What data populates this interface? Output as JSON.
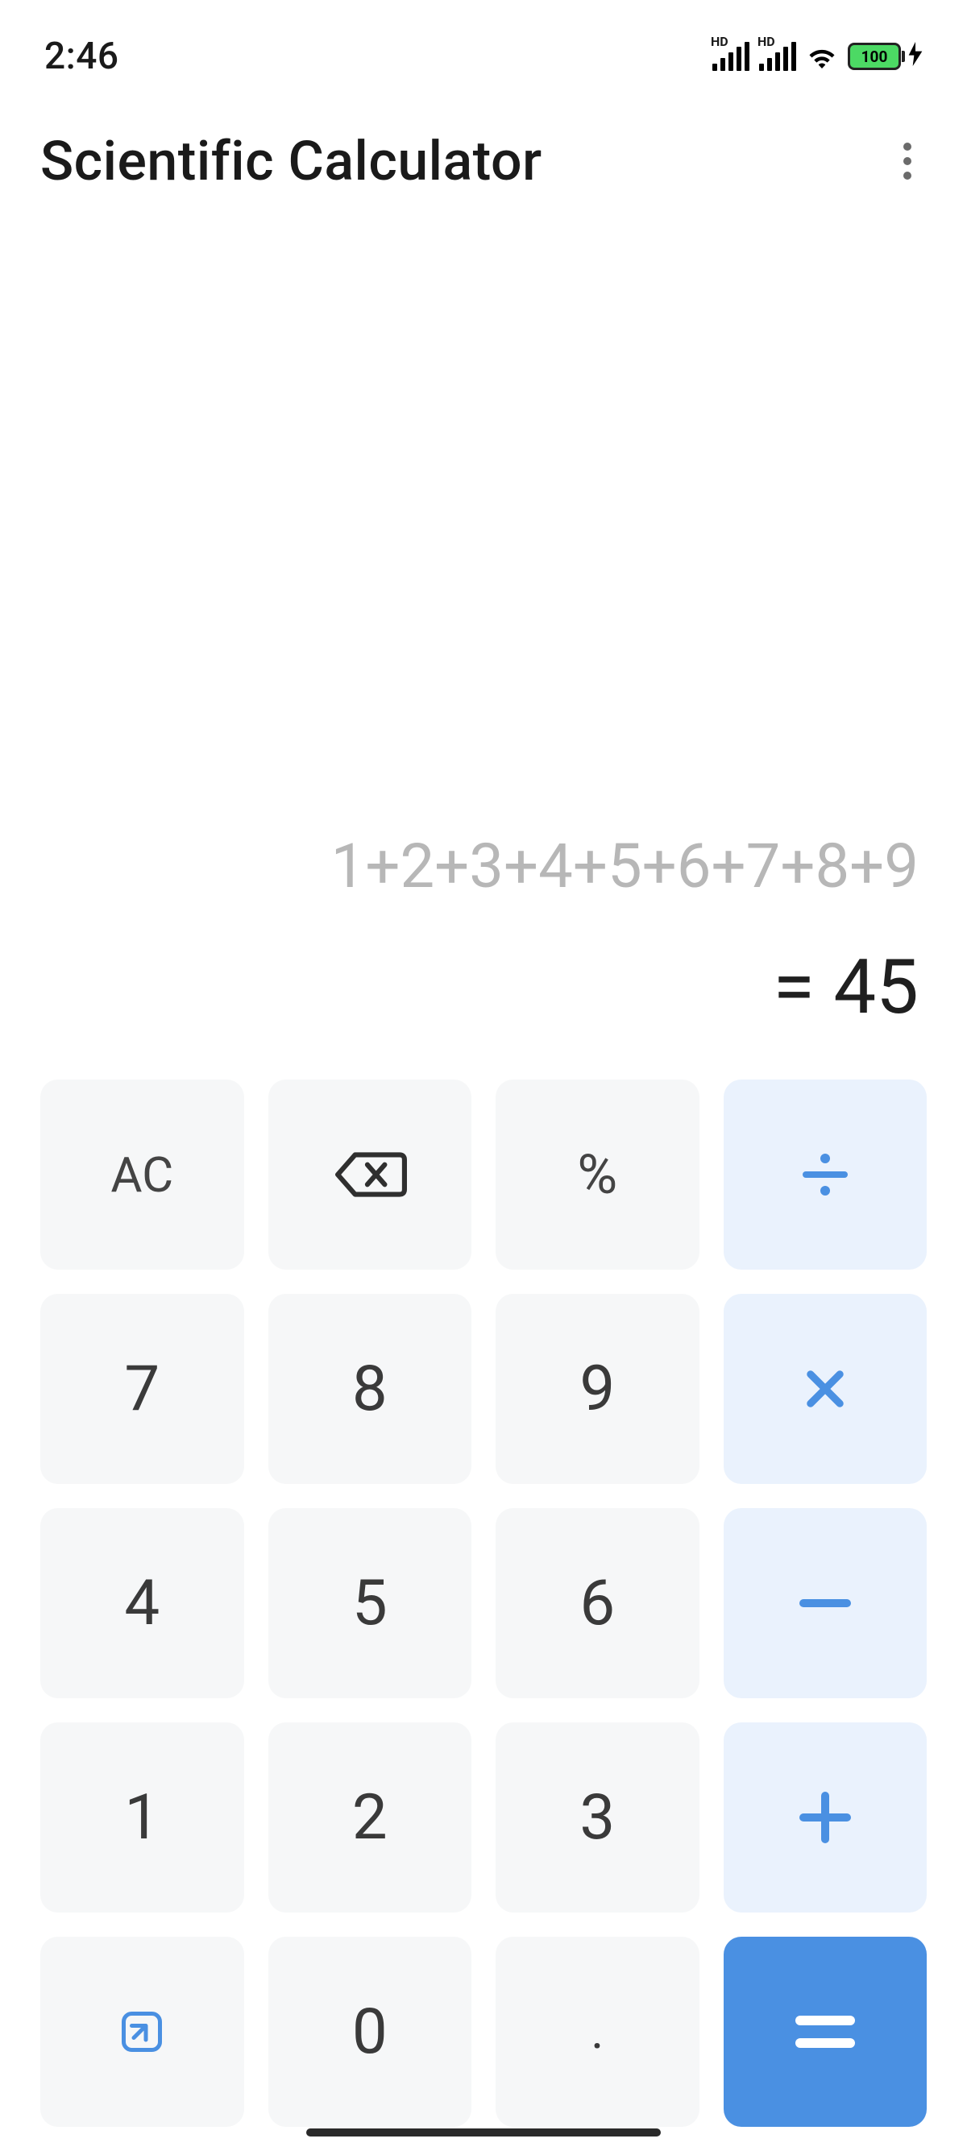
{
  "status": {
    "time": "2:46",
    "signal1_label": "HD",
    "signal2_label": "HD",
    "battery_percent": "100"
  },
  "header": {
    "title": "Scientific Calculator"
  },
  "display": {
    "expression": "1+2+3+4+5+6+7+8+9",
    "result": "= 45"
  },
  "keys": {
    "ac": "AC",
    "percent": "%",
    "seven": "7",
    "eight": "8",
    "nine": "9",
    "four": "4",
    "five": "5",
    "six": "6",
    "one": "1",
    "two": "2",
    "three": "3",
    "zero": "0",
    "dot": "."
  }
}
